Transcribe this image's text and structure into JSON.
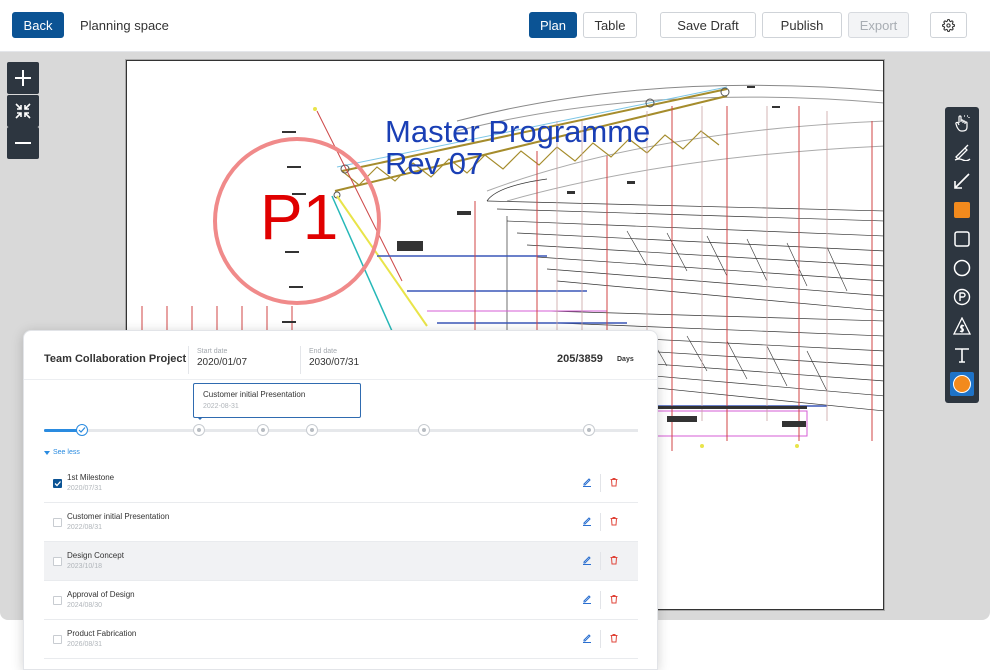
{
  "header": {
    "back_label": "Back",
    "page_title": "Planning space",
    "view_plan_label": "Plan",
    "view_table_label": "Table",
    "save_draft_label": "Save Draft",
    "publish_label": "Publish",
    "export_label": "Export",
    "settings_icon": "gear-icon"
  },
  "drawing": {
    "title_line1": "Master Programme",
    "title_line2": "Rev 07",
    "stamp": "P1"
  },
  "zoom": {
    "zoom_in_icon": "plus-icon",
    "fit_icon": "shrink-icon",
    "zoom_out_icon": "minus-icon"
  },
  "tools": {
    "active_color": "#f28a1d",
    "items": [
      "pointer-hand-icon",
      "pen-icon",
      "arrow-icon",
      "filled-square-icon",
      "square-icon",
      "circle-icon",
      "parking-marker-icon",
      "cost-marker-icon",
      "text-icon",
      "color-picker-icon"
    ]
  },
  "project": {
    "name": "Team Collaboration Project",
    "start_label": "Start date",
    "start_value": "2020/01/07",
    "end_label": "End date",
    "end_value": "2030/07/31",
    "days_value": "205/3859",
    "days_label": "Days",
    "progress": 0.05,
    "tooltip": {
      "title": "Customer initial Presentation",
      "date": "2022-08-31"
    },
    "see_less_label": "See less"
  },
  "milestones": [
    {
      "title": "1st Milestone",
      "date": "2020/07/31",
      "checked": true,
      "highlighted": false
    },
    {
      "title": "Customer initial Presentation",
      "date": "2022/08/31",
      "checked": false,
      "highlighted": false
    },
    {
      "title": "Design Concept",
      "date": "2023/10/18",
      "checked": false,
      "highlighted": true
    },
    {
      "title": "Approval of Design",
      "date": "2024/08/30",
      "checked": false,
      "highlighted": false
    },
    {
      "title": "Product Fabrication",
      "date": "2026/08/31",
      "checked": false,
      "highlighted": false
    }
  ],
  "colors": {
    "primary": "#0b5394",
    "accent": "#2a8be0",
    "delete": "#e0453a",
    "drawing_title": "#1a3fb5",
    "stamp": "#e00000",
    "stamp_circle": "#f08a8a"
  }
}
